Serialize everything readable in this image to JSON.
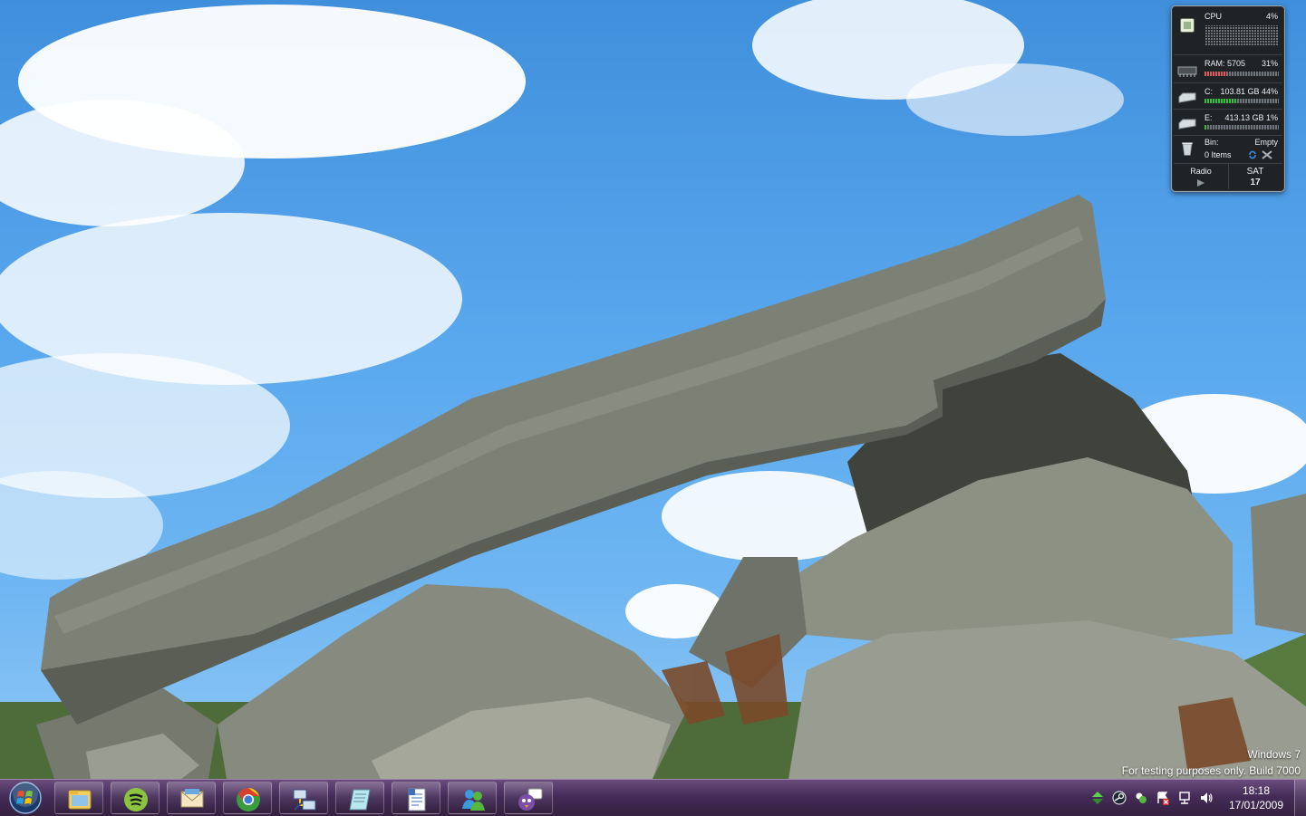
{
  "gadget": {
    "cpu": {
      "label": "CPU",
      "percent": "4%",
      "load_fraction": 0.04
    },
    "ram": {
      "label": "RAM: 5705",
      "percent": "31%",
      "load_fraction": 0.31
    },
    "drive_c": {
      "label": "C:",
      "size": "103.81 GB",
      "percent": "44%",
      "load_fraction": 0.44
    },
    "drive_e": {
      "label": "E:",
      "size": "413.13 GB",
      "percent": "1%",
      "load_fraction": 0.01
    },
    "bin": {
      "label": "Bin:",
      "status": "Empty",
      "items": "0 Items"
    },
    "radio": {
      "label": "Radio"
    },
    "calendar": {
      "day": "SAT",
      "date": "17"
    }
  },
  "watermark": {
    "line1": "Windows 7",
    "line2": "For testing purposes only. Build 7000"
  },
  "taskbar": {
    "apps": [
      {
        "name": "Windows Explorer",
        "icon": "folder-icon"
      },
      {
        "name": "Spotify",
        "icon": "spotify-icon"
      },
      {
        "name": "Mail",
        "icon": "mail-icon"
      },
      {
        "name": "Google Chrome",
        "icon": "chrome-icon"
      },
      {
        "name": "Network Connections",
        "icon": "network-icon"
      },
      {
        "name": "Notepad",
        "icon": "notepad-icon"
      },
      {
        "name": "WordPad",
        "icon": "wordpad-icon"
      },
      {
        "name": "Windows Live Messenger",
        "icon": "messenger-icon"
      },
      {
        "name": "Pidgin",
        "icon": "pidgin-icon"
      }
    ],
    "clock": {
      "time": "18:18",
      "date": "17/01/2009"
    }
  },
  "colors": {
    "taskbar": "#452c58",
    "ram_bar": "#d85a5a",
    "disk_bar": "#2fbf3a"
  }
}
